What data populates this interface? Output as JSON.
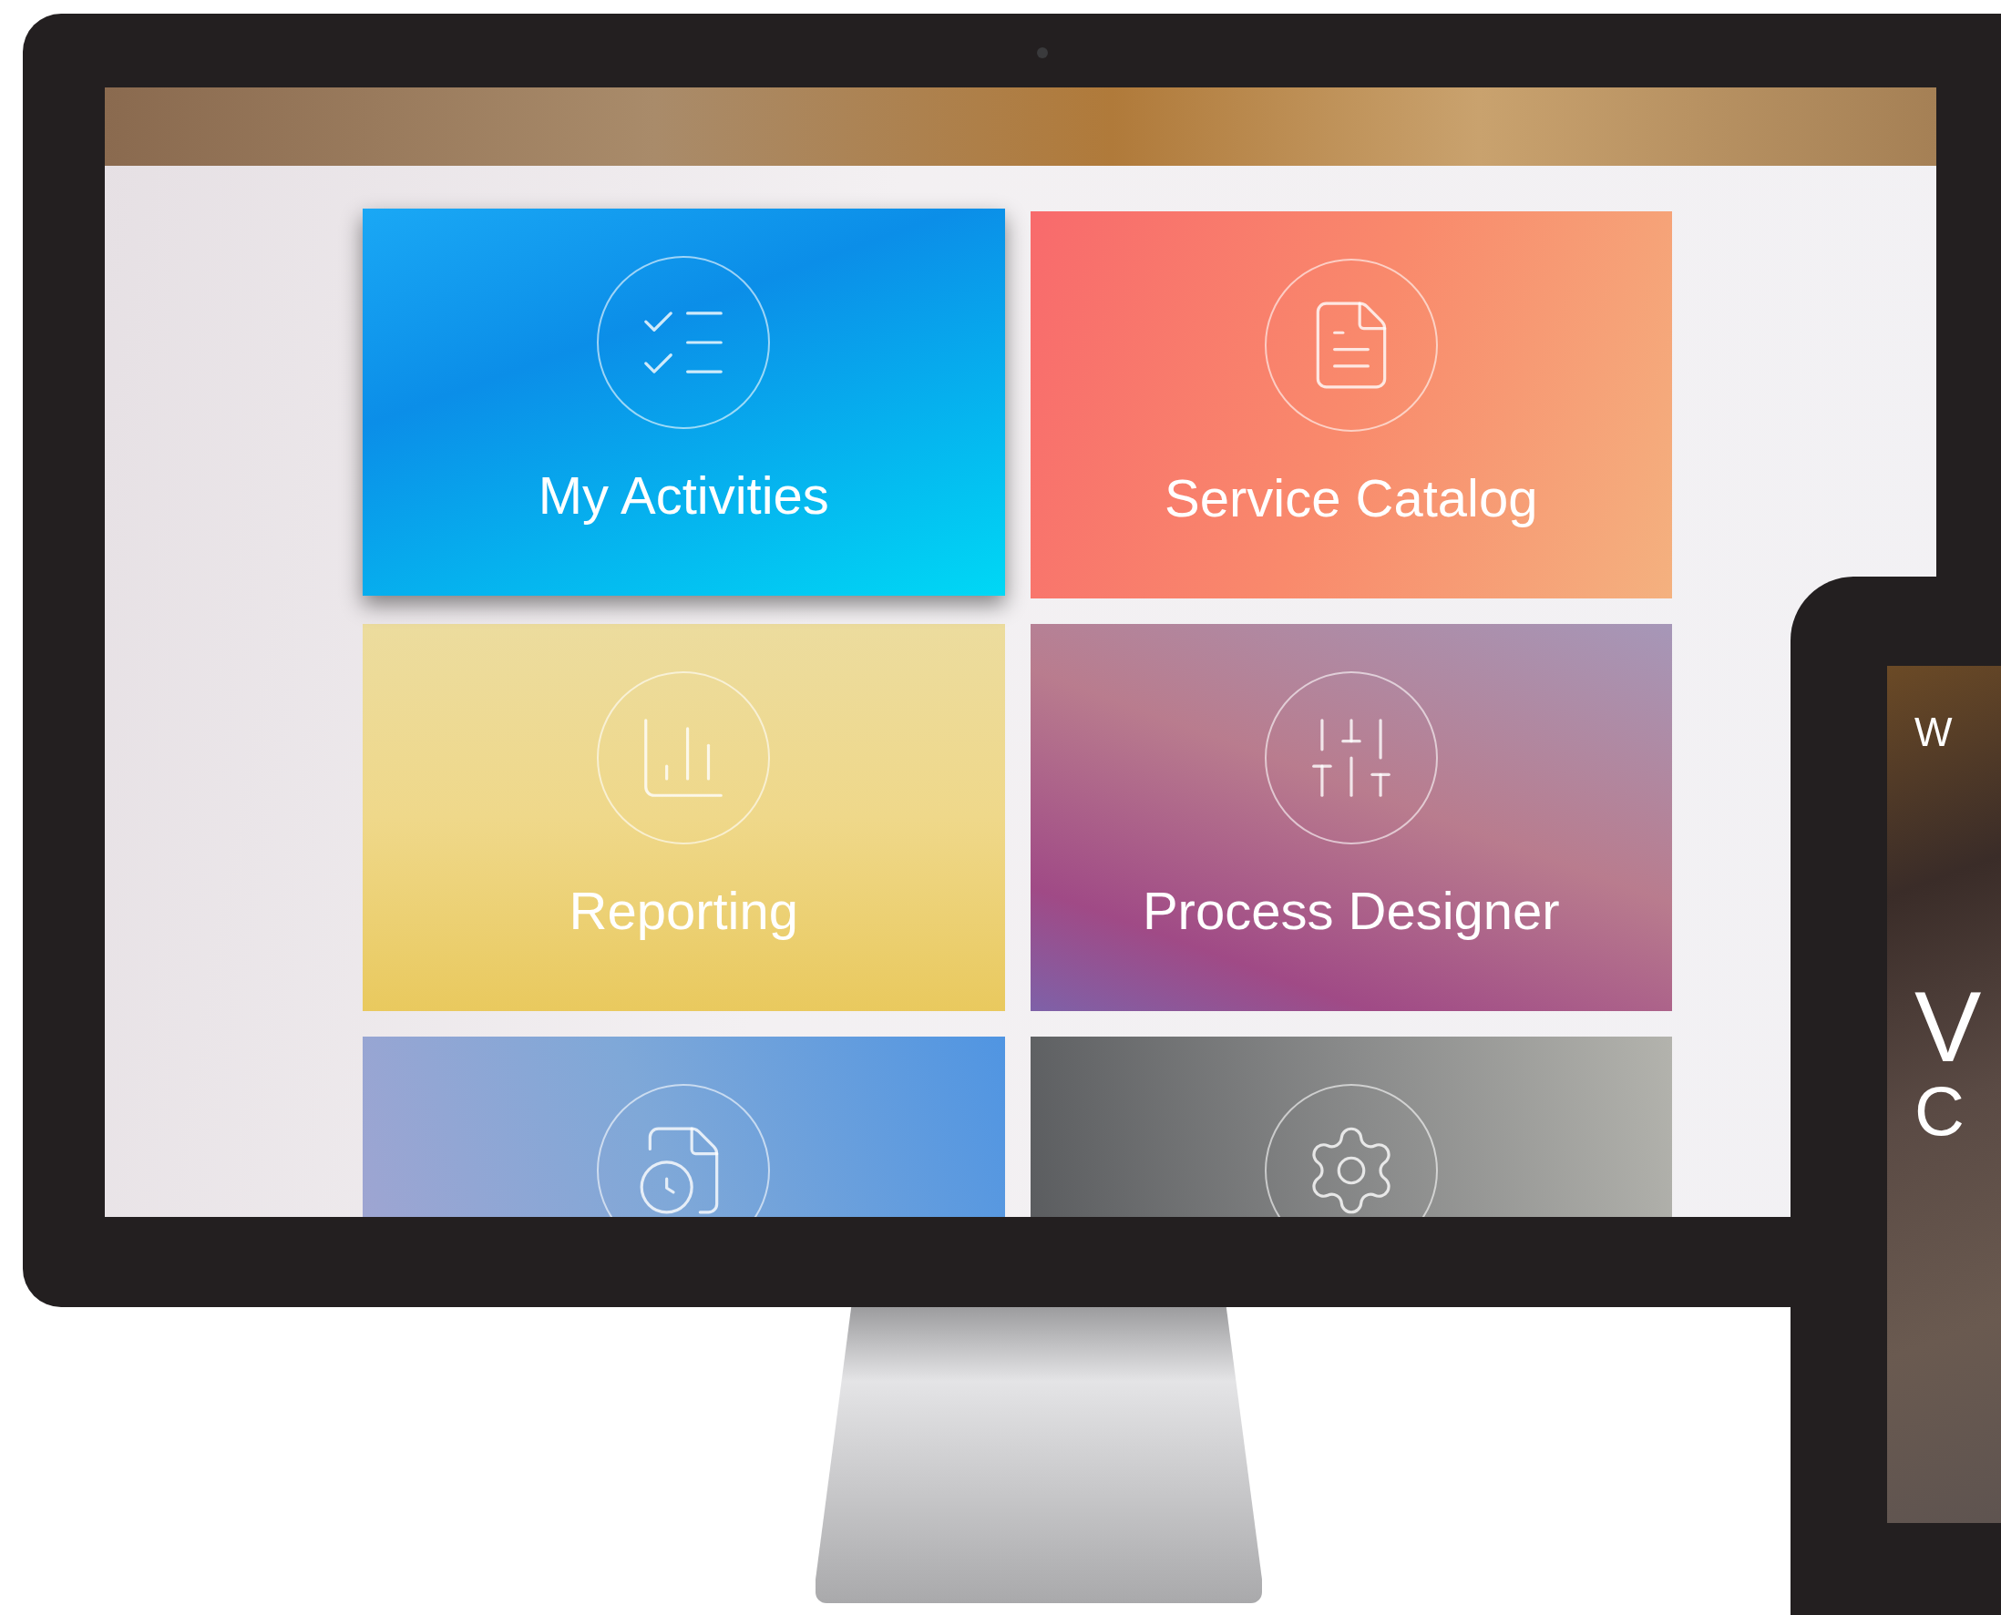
{
  "monitor": {
    "tiles": [
      {
        "kind": "activities",
        "label": "My Activities",
        "selected": true
      },
      {
        "kind": "catalog",
        "label": "Service Catalog",
        "selected": false
      },
      {
        "kind": "reporting",
        "label": "Reporting",
        "selected": false
      },
      {
        "kind": "designer",
        "label": "Process Designer",
        "selected": false
      },
      {
        "kind": "documents",
        "selected": false
      },
      {
        "kind": "settings",
        "selected": false
      }
    ]
  },
  "tablet": {
    "texts": [
      {
        "kind": "small",
        "text": "W"
      },
      {
        "kind": "large",
        "text": "V"
      },
      {
        "kind": "medium",
        "text": "C"
      }
    ]
  }
}
